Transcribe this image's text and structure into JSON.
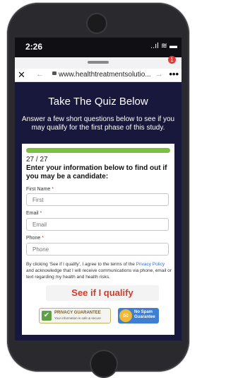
{
  "status_bar": {
    "time": "2:26",
    "icons": "..ıl ≋ ▬"
  },
  "background_page": {
    "notification_count": "1"
  },
  "browser": {
    "close_symbol": "✕",
    "back_symbol": "←",
    "url": "www.healthtreatmentsolutio...",
    "forward_symbol": "→",
    "more_symbol": "•••"
  },
  "headline": "Take The Quiz Below",
  "subheadline": "Answer a few short questions below to see if you may qualify for the first phase of this study.",
  "quiz": {
    "progress": 1.0,
    "progress_color": "#7bc043",
    "step_counter": "27 / 27",
    "lead": "Enter your information below to find out if you may be a candidate:",
    "fields": [
      {
        "label": "First Name",
        "required_mark": "*",
        "placeholder": "First"
      },
      {
        "label": "Email",
        "required_mark": "*",
        "placeholder": "Email"
      },
      {
        "label": "Phone",
        "required_mark": "*",
        "placeholder": "Phone"
      }
    ],
    "consent": {
      "part1": "By clicking 'See if I qualify', I agree to the terms of the ",
      "link": "Privacy Policy",
      "part2": " and acknowledge that I will receive communications via phone, email or text regarding my health and health risks."
    },
    "submit_label": "See if I qualify",
    "submit_color": "#d43a2a"
  },
  "badges": {
    "privacy_title": "PRIVACY GUARANTEE",
    "privacy_sub": "Your information is safe & secure",
    "no_spam_line1": "No Spam",
    "no_spam_line2": "Guarantee"
  },
  "colors": {
    "page_bg": "#17183b",
    "link": "#2f6bd6"
  }
}
